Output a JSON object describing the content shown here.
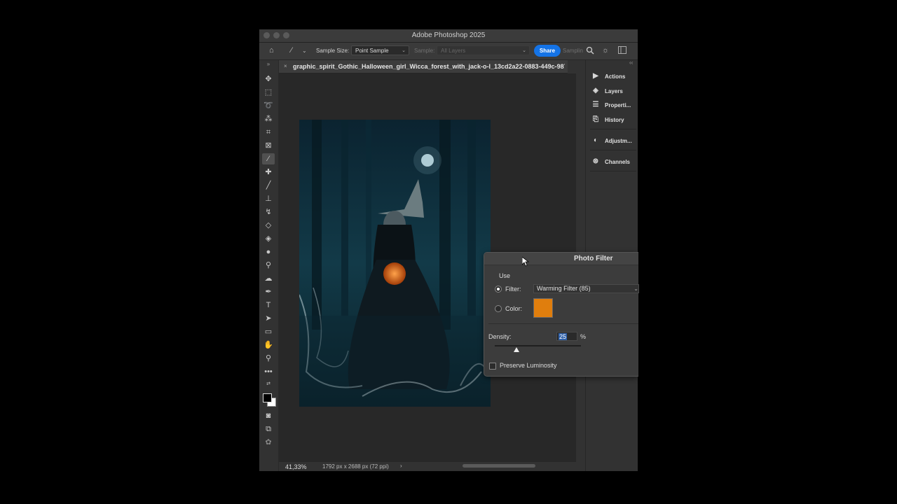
{
  "window": {
    "title": "Adobe Photoshop 2025"
  },
  "options_bar": {
    "sample_size_label": "Sample Size:",
    "sample_size_value": "Point Sample",
    "sample_label": "Sample:",
    "sample_value": "All Layers",
    "share_label": "Share",
    "sampling_label": "Samplin"
  },
  "document": {
    "tab_name": "graphic_spirit_Gothic_Halloween_girl_Wicca_forest_with_jack-o-l_13cd2a22-0883-449c-987"
  },
  "status": {
    "zoom": "41,33%",
    "dimensions": "1792 px x 2688 px (72 ppi)"
  },
  "panels": [
    {
      "label": "Actions",
      "icon": "play-icon"
    },
    {
      "label": "Layers",
      "icon": "layers-icon"
    },
    {
      "label": "Properti...",
      "icon": "sliders-icon"
    },
    {
      "label": "History",
      "icon": "history-icon"
    },
    {
      "label": "Adjustm...",
      "icon": "adjustments-icon"
    },
    {
      "label": "Channels",
      "icon": "channels-icon"
    }
  ],
  "photo_filter": {
    "title": "Photo Filter",
    "use_label": "Use",
    "filter_label": "Filter:",
    "filter_value": "Warming Filter (85)",
    "color_label": "Color:",
    "color_value": "#e07e0d",
    "density_label": "Density:",
    "density_value": "25",
    "density_unit": "%",
    "density_fraction": 0.25,
    "preserve_label": "Preserve Luminosity",
    "preserve_checked": false,
    "filter_selected": true
  }
}
